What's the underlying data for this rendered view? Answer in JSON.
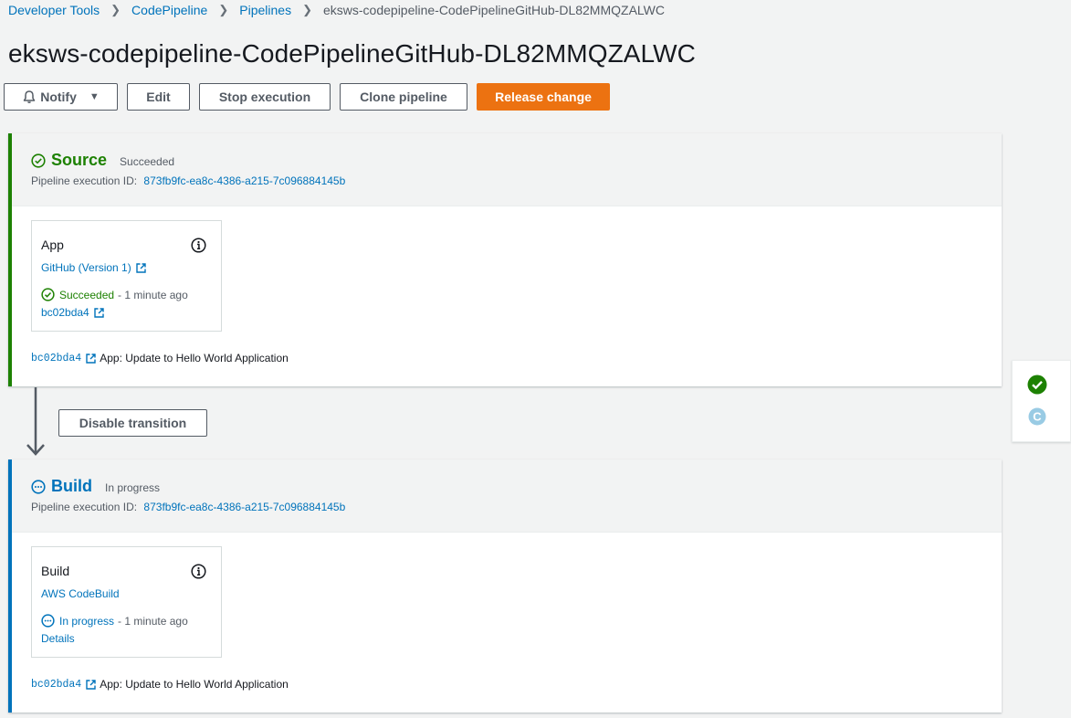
{
  "breadcrumb": [
    {
      "label": "Developer Tools"
    },
    {
      "label": "CodePipeline"
    },
    {
      "label": "Pipelines"
    }
  ],
  "breadcrumb_current": "eksws-codepipeline-CodePipelineGitHub-DL82MMQZALWC",
  "page_title": "eksws-codepipeline-CodePipelineGitHub-DL82MMQZALWC",
  "toolbar": {
    "notify": "Notify",
    "edit": "Edit",
    "stop": "Stop execution",
    "clone": "Clone pipeline",
    "release": "Release change"
  },
  "colors": {
    "success": "#1d8102",
    "in_progress": "#0073bb",
    "primary_button": "#ec7211",
    "link": "#0073bb"
  },
  "stages": [
    {
      "name": "Source",
      "status": "Succeeded",
      "status_icon": "check-circle-icon",
      "exec_label": "Pipeline execution ID:",
      "exec_id": "873fb9fc-ea8c-4386-a215-7c096884145b",
      "action": {
        "name": "App",
        "provider": "GitHub (Version 1)",
        "status": "Succeeded",
        "time": "- 1 minute ago",
        "link": "bc02bda4"
      },
      "commit_id": "bc02bda4",
      "commit_msg": "App: Update to Hello World Application"
    },
    {
      "name": "Build",
      "status": "In progress",
      "status_icon": "in-progress-icon",
      "exec_label": "Pipeline execution ID:",
      "exec_id": "873fb9fc-ea8c-4386-a215-7c096884145b",
      "action": {
        "name": "Build",
        "provider": "AWS CodeBuild",
        "status": "In progress",
        "time": "- 1 minute ago",
        "link": "Details"
      },
      "commit_id": "bc02bda4",
      "commit_msg": "App: Update to Hello World Application"
    }
  ],
  "transition_button": "Disable transition",
  "side_panel": {
    "items": [
      {
        "icon": "check-circle-icon",
        "color": "#1d8102"
      },
      {
        "icon": "c-letter-icon",
        "letter": "C",
        "color": "#99cbe4"
      }
    ]
  }
}
